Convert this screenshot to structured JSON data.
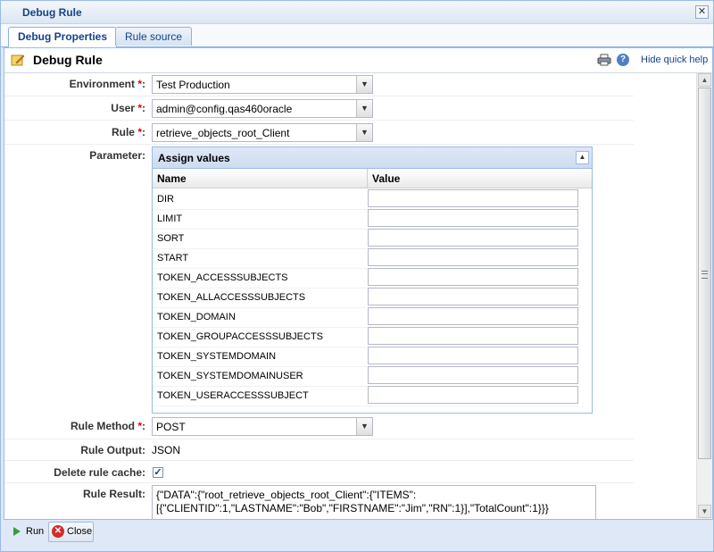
{
  "window": {
    "title": "Debug Rule"
  },
  "tabs": [
    {
      "label": "Debug Properties",
      "active": true
    },
    {
      "label": "Rule source",
      "active": false
    }
  ],
  "panel": {
    "heading": "Debug Rule",
    "hide_help": "Hide quick help"
  },
  "form": {
    "environment": {
      "label": "Environment",
      "value": "Test Production"
    },
    "user": {
      "label": "User",
      "value": "admin@config.qas460oracle"
    },
    "rule": {
      "label": "Rule",
      "value": "retrieve_objects_root_Client"
    },
    "parameter": {
      "label": "Parameter:"
    },
    "rule_method": {
      "label": "Rule Method",
      "value": "POST"
    },
    "rule_output": {
      "label": "Rule Output:",
      "value": "JSON"
    },
    "delete_cache": {
      "label": "Delete rule cache:",
      "checked": true
    },
    "rule_result": {
      "label": "Rule Result:",
      "value": "{\"DATA\":{\"root_retrieve_objects_root_Client\":{\"ITEMS\":[{\"CLIENTID\":1,\"LASTNAME\":\"Bob\",\"FIRSTNAME\":\"Jim\",\"RN\":1}],\"TotalCount\":1}}}"
    }
  },
  "grid": {
    "title": "Assign values",
    "columns": [
      "Name",
      "Value"
    ],
    "rows": [
      "DIR",
      "LIMIT",
      "SORT",
      "START",
      "TOKEN_ACCESSSUBJECTS",
      "TOKEN_ALLACCESSSUBJECTS",
      "TOKEN_DOMAIN",
      "TOKEN_GROUPACCESSSUBJECTS",
      "TOKEN_SYSTEMDOMAIN",
      "TOKEN_SYSTEMDOMAINUSER",
      "TOKEN_USERACCESSSUBJECT"
    ]
  },
  "footer": {
    "run_label": "Run",
    "close_label": "Close"
  },
  "icons": {
    "run": "play-icon",
    "close": "close-circle-icon",
    "print": "printer-icon",
    "help": "help-icon"
  }
}
